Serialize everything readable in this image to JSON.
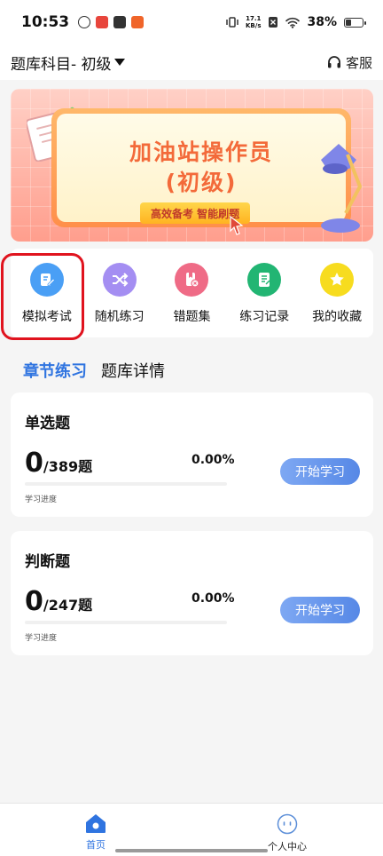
{
  "status_bar": {
    "time": "10:53",
    "net_speed_value": "17.1",
    "net_speed_unit": "KB/s",
    "battery_percent": "38%",
    "battery_level": 0.38
  },
  "header": {
    "subject": "题库科目- 初级",
    "service_label": "客服"
  },
  "banner": {
    "title": "加油站操作员",
    "subtitle": "(初级)",
    "tag": "高效备考 智能刷题"
  },
  "quick_actions": [
    {
      "label": "模拟考试",
      "icon": "exam-edit-icon",
      "color": "#4a9ff5"
    },
    {
      "label": "随机练习",
      "icon": "shuffle-icon",
      "color": "#a48ef2"
    },
    {
      "label": "错题集",
      "icon": "wrong-book-icon",
      "color": "#ef6b86"
    },
    {
      "label": "练习记录",
      "icon": "record-icon",
      "color": "#22b573"
    },
    {
      "label": "我的收藏",
      "icon": "star-icon",
      "color": "#f7dc1f"
    }
  ],
  "tabs": [
    {
      "label": "章节练习",
      "active": true
    },
    {
      "label": "题库详情",
      "active": false
    }
  ],
  "practice": [
    {
      "title": "单选题",
      "done": "0",
      "total": "/389题",
      "percent": "0.00%",
      "progress": 0,
      "progress_label": "学习进度",
      "button": "开始学习"
    },
    {
      "title": "判断题",
      "done": "0",
      "total": "/247题",
      "percent": "0.00%",
      "progress": 0,
      "progress_label": "学习进度",
      "button": "开始学习"
    }
  ],
  "bottom_nav": [
    {
      "label": "首页",
      "active": true,
      "icon": "home-icon"
    },
    {
      "label": "个人中心",
      "active": false,
      "icon": "profile-face-icon"
    }
  ]
}
